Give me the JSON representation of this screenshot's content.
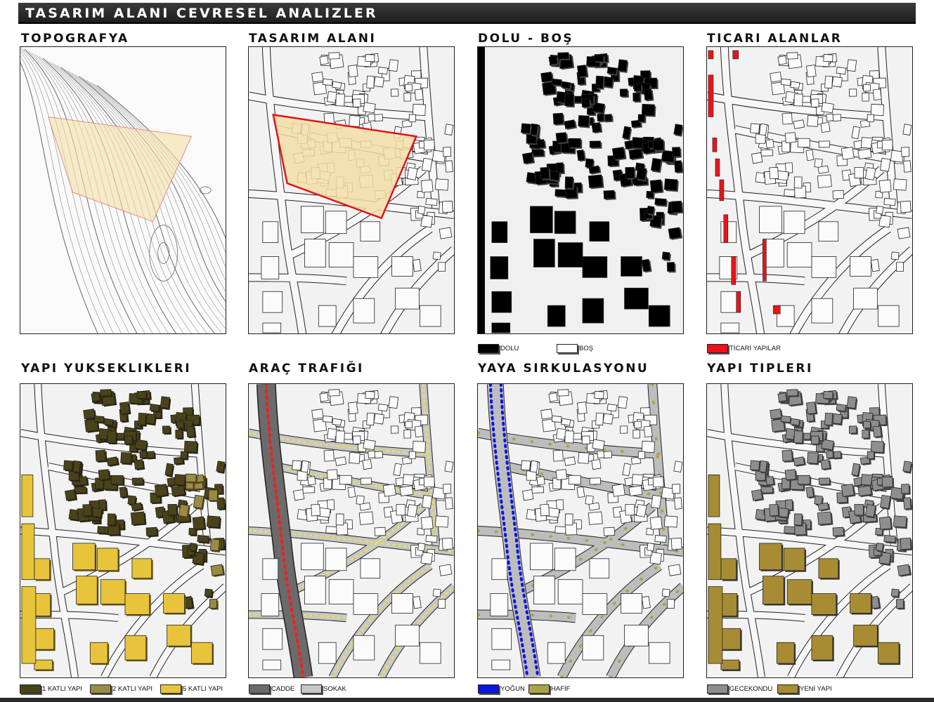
{
  "header": {
    "title": "TASARIM ALANI CEVRESEL ANALIZLER"
  },
  "panels": {
    "topo": {
      "title": "TOPOGRAFYA"
    },
    "site": {
      "title": "TASARIM ALANI"
    },
    "figure": {
      "title": "DOLU - BOŞ",
      "legend": [
        "DOLU",
        "BOŞ"
      ]
    },
    "commercial": {
      "title": "TICARI ALANLAR",
      "legend": [
        "TİCARİ YAPILAR"
      ]
    },
    "heights": {
      "title": "YAPI YUKSEKLIKLERI",
      "legend": [
        "1 KATLI YAPI",
        "2 KATLI YAPI",
        "5 KATLI YAPI"
      ]
    },
    "traffic": {
      "title": "ARAÇ TRAFIĞI",
      "legend": [
        "CADDE",
        "SOKAK"
      ]
    },
    "pedestrian": {
      "title": "YAYA SIRKULASYONU",
      "legend": [
        "YOĞUN",
        "HAFİF"
      ]
    },
    "types": {
      "title": "YAPI TIPLERI",
      "legend": [
        "GECEKONDU",
        "YENİ YAPI"
      ]
    }
  },
  "colors": {
    "commercial": "#e8141a",
    "site_fill": "#f3dfa6",
    "site_border": "#e5131b",
    "floor1": "#4a4219",
    "floor2": "#9b8a43",
    "floor5": "#e7c43c",
    "cadde": "#6b6b6b",
    "sokak": "#c7c7c7",
    "yogun": "#0a14e6",
    "hafif": "#a9a445",
    "gecekondu": "#8e8e8e",
    "yeni_yapi": "#a88c34"
  }
}
